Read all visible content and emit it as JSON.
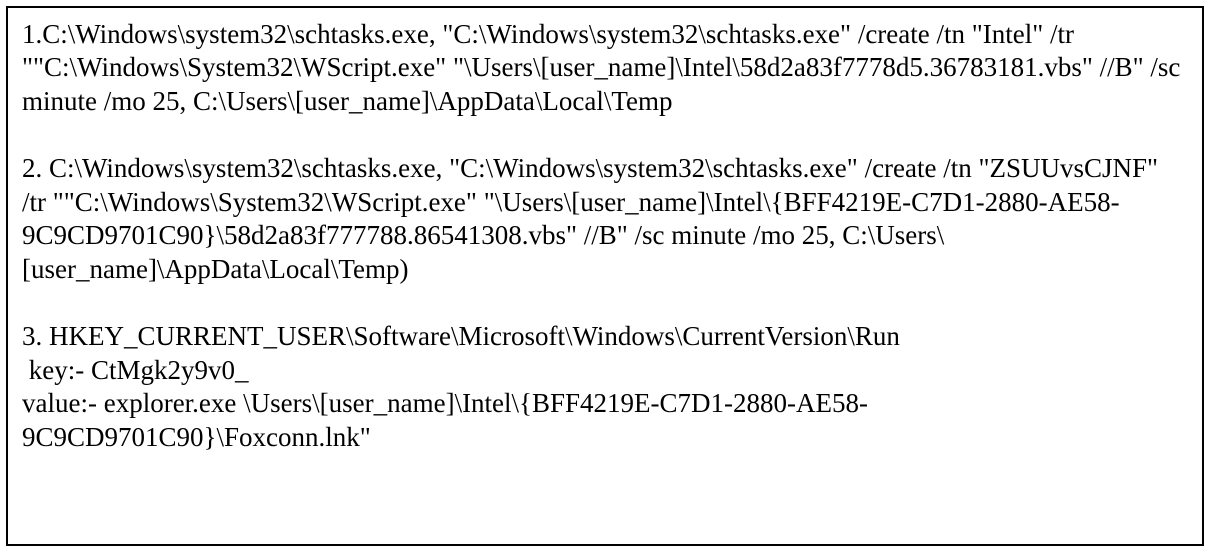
{
  "items": [
    {
      "text": "1.C:\\Windows\\system32\\schtasks.exe, \"C:\\Windows\\system32\\schtasks.exe\" /create /tn \"Intel\" /tr \"\"C:\\Windows\\System32\\WScript.exe\" \"\\Users\\[user_name]\\Intel\\58d2a83f7778d5.36783181.vbs\" //B\" /sc minute /mo 25, C:\\Users\\[user_name]\\AppData\\Local\\Temp"
    },
    {
      "text": "2. C:\\Windows\\system32\\schtasks.exe, \"C:\\Windows\\system32\\schtasks.exe\" /create /tn \"ZSUUvsCJNF\" /tr \"\"C:\\Windows\\System32\\WScript.exe\" \"\\Users\\[user_name]\\Intel\\{BFF4219E-C7D1-2880-AE58-9C9CD9701C90}\\58d2a83f777788.86541308.vbs\" //B\" /sc minute /mo 25, C:\\Users\\[user_name]\\AppData\\Local\\Temp)"
    },
    {
      "text": "3. HKEY_CURRENT_USER\\Software\\Microsoft\\Windows\\CurrentVersion\\Run\n key:- CtMgk2y9v0_\nvalue:- explorer.exe \\Users\\[user_name]\\Intel\\{BFF4219E-C7D1-2880-AE58-9C9CD9701C90}\\Foxconn.lnk\""
    }
  ]
}
